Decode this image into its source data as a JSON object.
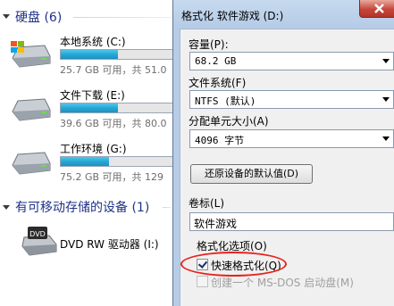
{
  "explorer": {
    "hard_disks": {
      "title": "硬盘 (6)"
    },
    "drives": [
      {
        "name": "本地系统 (C:)",
        "info": "25.7 GB 可用，共 51.0",
        "used_fraction": 0.5
      },
      {
        "name": "文件下载 (E:)",
        "info": "39.6 GB 可用，共 80.0",
        "used_fraction": 0.5
      },
      {
        "name": "工作环境 (G:)",
        "info": "75.2 GB 可用，共 129",
        "used_fraction": 0.42
      }
    ],
    "removable": {
      "title": "有可移动存储的设备 (1)"
    },
    "dvd": {
      "name": "DVD RW 驱动器 (I:)",
      "icon_label": "DVD"
    }
  },
  "dialog": {
    "title": "格式化 软件游戏 (D:)",
    "capacity": {
      "label": "容量(P):",
      "value": "68.2 GB"
    },
    "filesystem": {
      "label": "文件系统(F)",
      "value": "NTFS (默认)"
    },
    "alloc": {
      "label": "分配单元大小(A)",
      "value": "4096 字节"
    },
    "restore_label": "还原设备的默认值(D)",
    "volume": {
      "label": "卷标(L)",
      "value": "软件游戏"
    },
    "options": {
      "label": "格式化选项(O)",
      "quick_format": "快速格式化(Q)",
      "quick_checked": true,
      "msdos": "创建一个 MS-DOS 启动盘(M)",
      "msdos_checked": false
    }
  },
  "colors": {
    "annotation_ring": "#e8221c",
    "group_header": "#1e3287",
    "usage_bar": "#27a7d6"
  }
}
